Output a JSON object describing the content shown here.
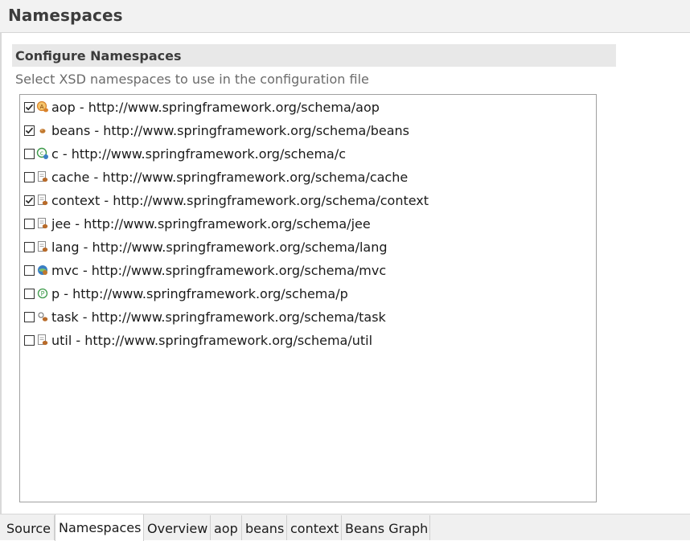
{
  "header": {
    "title": "Namespaces"
  },
  "section": {
    "title": "Configure Namespaces",
    "description": "Select XSD namespaces to use in the configuration file"
  },
  "namespaces": [
    {
      "label": "aop - http://www.springframework.org/schema/aop",
      "checked": true,
      "icon": "aop-icon",
      "icon_color": "#d9822b"
    },
    {
      "label": "beans - http://www.springframework.org/schema/beans",
      "checked": true,
      "icon": "beans-icon",
      "icon_color": "#c0782e"
    },
    {
      "label": "c - http://www.springframework.org/schema/c",
      "checked": false,
      "icon": "c-namespace-icon",
      "icon_color": "#3d9a4a"
    },
    {
      "label": "cache - http://www.springframework.org/schema/cache",
      "checked": false,
      "icon": "cache-icon",
      "icon_color": "#b86b2a"
    },
    {
      "label": "context - http://www.springframework.org/schema/context",
      "checked": true,
      "icon": "context-icon",
      "icon_color": "#b86b2a"
    },
    {
      "label": "jee - http://www.springframework.org/schema/jee",
      "checked": false,
      "icon": "jee-icon",
      "icon_color": "#b86b2a"
    },
    {
      "label": "lang - http://www.springframework.org/schema/lang",
      "checked": false,
      "icon": "lang-icon",
      "icon_color": "#b86b2a"
    },
    {
      "label": "mvc - http://www.springframework.org/schema/mvc",
      "checked": false,
      "icon": "mvc-icon",
      "icon_color": "#3a7fc4"
    },
    {
      "label": "p - http://www.springframework.org/schema/p",
      "checked": false,
      "icon": "p-namespace-icon",
      "icon_color": "#3d9a4a"
    },
    {
      "label": "task - http://www.springframework.org/schema/task",
      "checked": false,
      "icon": "task-icon",
      "icon_color": "#b86b2a"
    },
    {
      "label": "util - http://www.springframework.org/schema/util",
      "checked": false,
      "icon": "util-icon",
      "icon_color": "#b86b2a"
    }
  ],
  "tabs": [
    {
      "label": "Source",
      "active": false
    },
    {
      "label": "Namespaces",
      "active": true
    },
    {
      "label": "Overview",
      "active": false
    },
    {
      "label": "aop",
      "active": false
    },
    {
      "label": "beans",
      "active": false
    },
    {
      "label": "context",
      "active": false
    },
    {
      "label": "Beans Graph",
      "active": false
    }
  ]
}
